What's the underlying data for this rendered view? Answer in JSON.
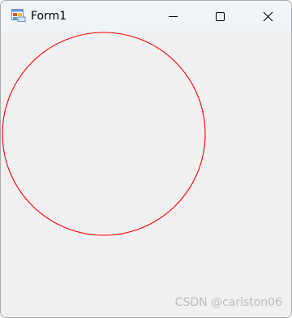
{
  "window": {
    "title": "Form1",
    "controls": [
      "minimize-icon",
      "maximize-icon",
      "close-icon"
    ]
  },
  "canvas": {
    "shape": "circle",
    "stroke_color": "#ff0000"
  },
  "watermark": "CSDN @carlston06"
}
